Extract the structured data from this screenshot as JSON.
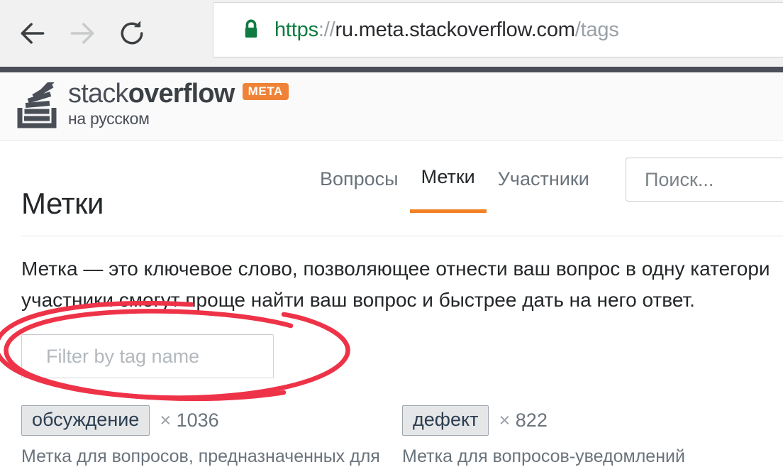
{
  "browser": {
    "back_icon": "arrow-left-icon",
    "forward_icon": "arrow-right-icon",
    "reload_icon": "reload-icon",
    "lock_icon": "lock-icon",
    "url": {
      "scheme": "https",
      "separator": "://",
      "host": "ru.meta.stackoverflow.com",
      "path": "/tags"
    },
    "colors": {
      "chrome_bg": "#f1f1f1",
      "lock_green": "#0f7b41",
      "url_host": "#292a2d",
      "url_muted": "#9aa0a6"
    }
  },
  "site_header": {
    "logo": {
      "icon": "stack-overflow-logo-icon",
      "word_light": "stack",
      "word_bold": "overflow",
      "badge": "META",
      "subtitle": "на русском"
    },
    "nav": [
      {
        "label": "Вопросы",
        "active": false
      },
      {
        "label": "Метки",
        "active": true
      },
      {
        "label": "Участники",
        "active": false
      }
    ],
    "search": {
      "placeholder": "Поиск..."
    },
    "colors": {
      "top_strip": "#4a4e57",
      "header_bg": "#fafafb",
      "accent_orange": "#f48024",
      "badge_orange": "#ef8236"
    }
  },
  "main": {
    "title": "Метки",
    "intro_line_1": "Метка — это ключевое слово, позволяющее отнести ваш вопрос в одну категори",
    "intro_line_2": "участники смогут проще найти ваш вопрос и быстрее дать на него ответ.",
    "filter": {
      "placeholder": "Filter by tag name",
      "value": ""
    },
    "annotation": {
      "shape": "hand-drawn-ellipse",
      "color": "#ee3348",
      "target": "filter-by-tag-name-input"
    },
    "tags": [
      {
        "name": "обсуждение",
        "times_symbol": "×",
        "count": "1036",
        "description": "Метка для вопросов, предназначенных для"
      },
      {
        "name": "дефект",
        "times_symbol": "×",
        "count": "822",
        "description": "Метка для вопросов-уведомлений"
      }
    ]
  }
}
